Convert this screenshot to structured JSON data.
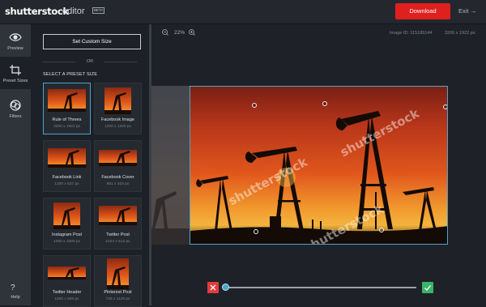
{
  "header": {
    "logo": "shutterstock",
    "logo_sub": "editor",
    "beta_badge": "BETA",
    "download_label": "Download",
    "exit_label": "Exit",
    "accent_color": "#e01f1f"
  },
  "rail": {
    "items": [
      {
        "label": "Preview",
        "icon": "eye-icon"
      },
      {
        "label": "Preset Sizes",
        "icon": "crop-icon"
      },
      {
        "label": "Filters",
        "icon": "filters-icon"
      }
    ],
    "help_mark": "?",
    "help_label": "Help"
  },
  "panel": {
    "custom_size_label": "Set Custom Size",
    "or_label": "OR",
    "preset_heading": "SELECT A PRESET SIZE",
    "presets": [
      {
        "name": "Rule of Threes",
        "size": "3200 x 1922 px"
      },
      {
        "name": "Facebook Image",
        "size": "1200 x 1200 px"
      },
      {
        "name": "Facebook Link",
        "size": "1200 x 627 px"
      },
      {
        "name": "Facebook Cover",
        "size": "851 x 315 px"
      },
      {
        "name": "Instagram Post",
        "size": "1080 x 1080 px"
      },
      {
        "name": "Twitter Post",
        "size": "1024 x 512 px"
      },
      {
        "name": "Twitter Header",
        "size": "1500 x 500 px"
      },
      {
        "name": "Pinterest Post",
        "size": "736 x 1128 px"
      }
    ],
    "selected_index": 0
  },
  "canvas": {
    "zoom_level": "22%",
    "image_id": "Image ID: 115189144",
    "image_dims": "3200 x 1922 px",
    "watermark": "shutterstock",
    "highlight_color": "#4da6c9"
  },
  "controls": {
    "slider_value": 0.0
  }
}
